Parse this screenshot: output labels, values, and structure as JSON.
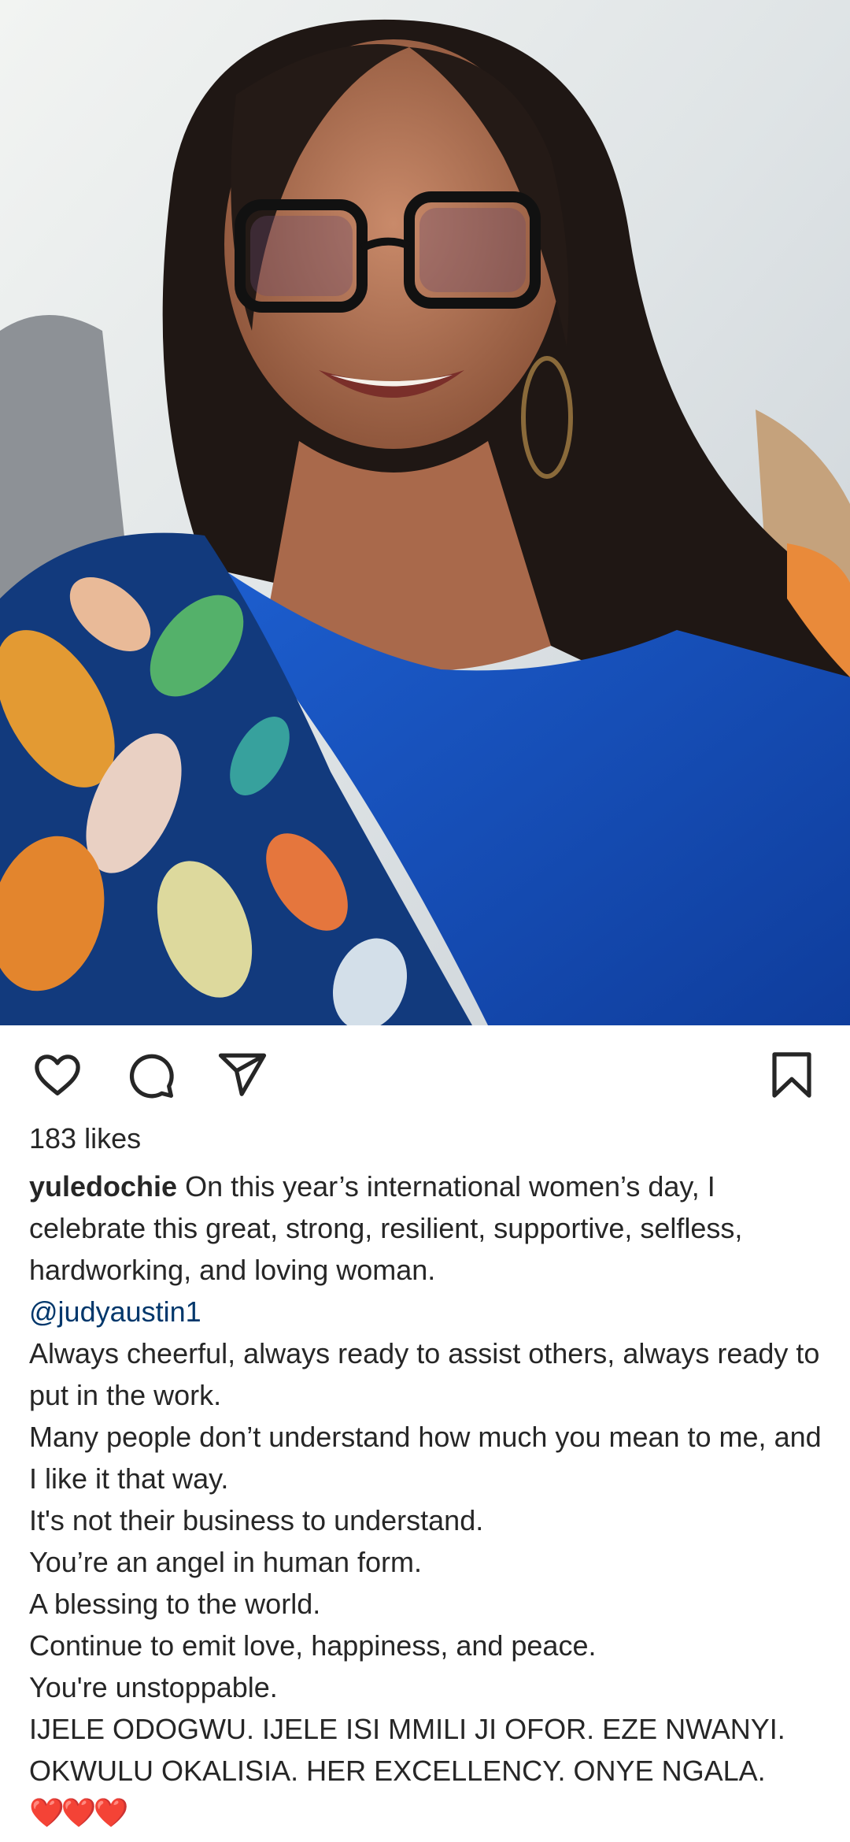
{
  "post": {
    "photo_alt": "Selfie of a smiling woman wearing glasses and a blue floral outfit"
  },
  "actions": {
    "like_icon": "heart-outline-icon",
    "comment_icon": "speech-bubble-icon",
    "share_icon": "paper-plane-icon",
    "save_icon": "bookmark-icon"
  },
  "likes": "183 likes",
  "caption": {
    "username": "yuledochie",
    "intro": " On this year’s international women’s day, I celebrate this great, strong, resilient, supportive, selfless, hardworking, and loving woman.",
    "mention": "@judyaustin1",
    "lines": [
      "Always cheerful, always ready to assist others, always ready to put in the work.",
      "Many people don’t understand how much you mean to me, and I like it that way.",
      "It's not their business to understand.",
      "You’re an angel in human form.",
      "A blessing to the world.",
      "Continue to emit love, happiness, and peace.",
      "You're unstoppable.",
      "IJELE ODOGWU. IJELE ISI MMILI JI OFOR. EZE NWANYI. OKWULU OKALISIA. HER EXCELLENCY. ONYE NGALA."
    ],
    "hearts": "❤️❤️❤️"
  },
  "colors": {
    "text": "#262626",
    "mention": "#00376b",
    "background": "#ffffff"
  }
}
